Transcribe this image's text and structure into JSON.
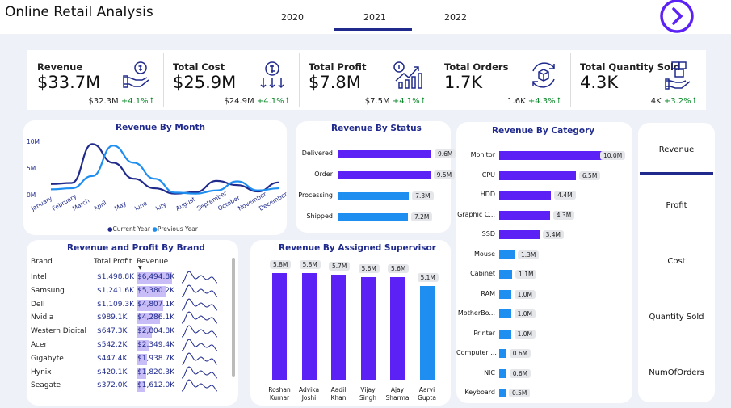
{
  "header": {
    "title": "Online Retail Analysis",
    "years": [
      "2020",
      "2021",
      "2022"
    ],
    "selected_year": "2021"
  },
  "kpis": [
    {
      "label": "Revenue",
      "value": "$33.7M",
      "prev": "$32.3M",
      "delta": "+4.1%↑",
      "icon": "money-hand-icon"
    },
    {
      "label": "Total Cost",
      "value": "$25.9M",
      "prev": "$24.9M",
      "delta": "+4.1%↑",
      "icon": "cost-down-icon"
    },
    {
      "label": "Total Profit",
      "value": "$7.8M",
      "prev": "$7.5M",
      "delta": "+4.1%↑",
      "icon": "profit-growth-icon"
    },
    {
      "label": "Total Orders",
      "value": "1.7K",
      "prev": "1.6K",
      "delta": "+4.3%↑",
      "icon": "orders-box-icon"
    },
    {
      "label": "Total Quantity Sold",
      "value": "4.3K",
      "prev": "4K",
      "delta": "+3.2%↑",
      "icon": "boxes-hand-icon"
    }
  ],
  "sidebar": {
    "items": [
      "Revenue",
      "Profit",
      "Cost",
      "Quantity Sold",
      "NumOfOrders"
    ],
    "selected": "Revenue"
  },
  "colors": {
    "dark_blue": "#1f2a8c",
    "purple": "#5b21f5",
    "light_blue": "#1f8ef1",
    "positive": "#0a8a2a"
  },
  "chart_data": [
    {
      "type": "line",
      "title": "Revenue By Month",
      "categories": [
        "January",
        "February",
        "March",
        "April",
        "May",
        "June",
        "July",
        "August",
        "September",
        "October",
        "November",
        "December"
      ],
      "yticks": [
        "10M",
        "5M",
        "0M"
      ],
      "ylim": [
        0,
        10
      ],
      "series": [
        {
          "name": "Current Year",
          "color": "#1f2a8c",
          "values": [
            2.0,
            2.2,
            9.5,
            6.0,
            3.0,
            1.2,
            0.2,
            0.5,
            2.6,
            1.8,
            0.6,
            2.3
          ]
        },
        {
          "name": "Previous Year",
          "color": "#1f8ef1",
          "values": [
            1.0,
            1.2,
            3.5,
            9.2,
            6.0,
            3.0,
            0.4,
            0.2,
            0.8,
            2.5,
            0.8,
            1.2
          ]
        }
      ],
      "legend": "bottom"
    },
    {
      "type": "bar",
      "title": "Revenue By Status",
      "categories": [
        "Delivered",
        "Order",
        "Processing",
        "Shipped"
      ],
      "values": [
        9.6,
        9.5,
        7.3,
        7.2
      ],
      "labels": [
        "9.6M",
        "9.5M",
        "7.3M",
        "7.2M"
      ],
      "colors": [
        "#5b21f5",
        "#5b21f5",
        "#1f8ef1",
        "#1f8ef1"
      ]
    },
    {
      "type": "bar",
      "title": "Revenue By Category",
      "categories": [
        "Monitor",
        "CPU",
        "HDD",
        "Graphic C...",
        "SSD",
        "Mouse",
        "Cabinet",
        "RAM",
        "MotherBo...",
        "Printer",
        "Computer ...",
        "NIC",
        "Keyboard"
      ],
      "values": [
        10.0,
        6.5,
        4.4,
        4.3,
        3.4,
        1.3,
        1.1,
        1.0,
        1.0,
        1.0,
        0.6,
        0.6,
        0.5
      ],
      "labels": [
        "10.0M",
        "6.5M",
        "4.4M",
        "4.3M",
        "3.4M",
        "1.3M",
        "1.1M",
        "1.0M",
        "1.0M",
        "1.0M",
        "0.6M",
        "0.6M",
        "0.5M"
      ]
    },
    {
      "type": "bar",
      "title": "Revenue By Assigned Supervisor",
      "categories": [
        "Roshan Kumar",
        "Advika Joshi",
        "Aadil Khan",
        "Vijay Singh",
        "Ajay Sharma",
        "Aarvi Gupta"
      ],
      "values": [
        5.8,
        5.8,
        5.7,
        5.6,
        5.6,
        5.1
      ],
      "labels": [
        "5.8M",
        "5.8M",
        "5.7M",
        "5.6M",
        "5.6M",
        "5.1M"
      ]
    },
    {
      "type": "table",
      "title": "Revenue and Profit By Brand",
      "columns": [
        "Brand",
        "Total Profit",
        "Revenue"
      ],
      "rows": [
        {
          "brand": "Intel",
          "profit": "$1,498.8K",
          "revenue": "$6,494.8K"
        },
        {
          "brand": "Samsung",
          "profit": "$1,241.6K",
          "revenue": "$5,380.2K"
        },
        {
          "brand": "Dell",
          "profit": "$1,109.3K",
          "revenue": "$4,807.1K"
        },
        {
          "brand": "Nvidia",
          "profit": "$989.1K",
          "revenue": "$4,286.1K"
        },
        {
          "brand": "Western Digital",
          "profit": "$647.3K",
          "revenue": "$2,804.8K"
        },
        {
          "brand": "Acer",
          "profit": "$542.2K",
          "revenue": "$2,349.4K"
        },
        {
          "brand": "Gigabyte",
          "profit": "$447.4K",
          "revenue": "$1,938.7K"
        },
        {
          "brand": "Hynix",
          "profit": "$420.1K",
          "revenue": "$1,820.3K"
        },
        {
          "brand": "Seagate",
          "profit": "$372.0K",
          "revenue": "$1,612.0K"
        }
      ],
      "revenue_fraction": [
        1.0,
        0.83,
        0.74,
        0.66,
        0.43,
        0.36,
        0.3,
        0.28,
        0.25
      ]
    }
  ]
}
